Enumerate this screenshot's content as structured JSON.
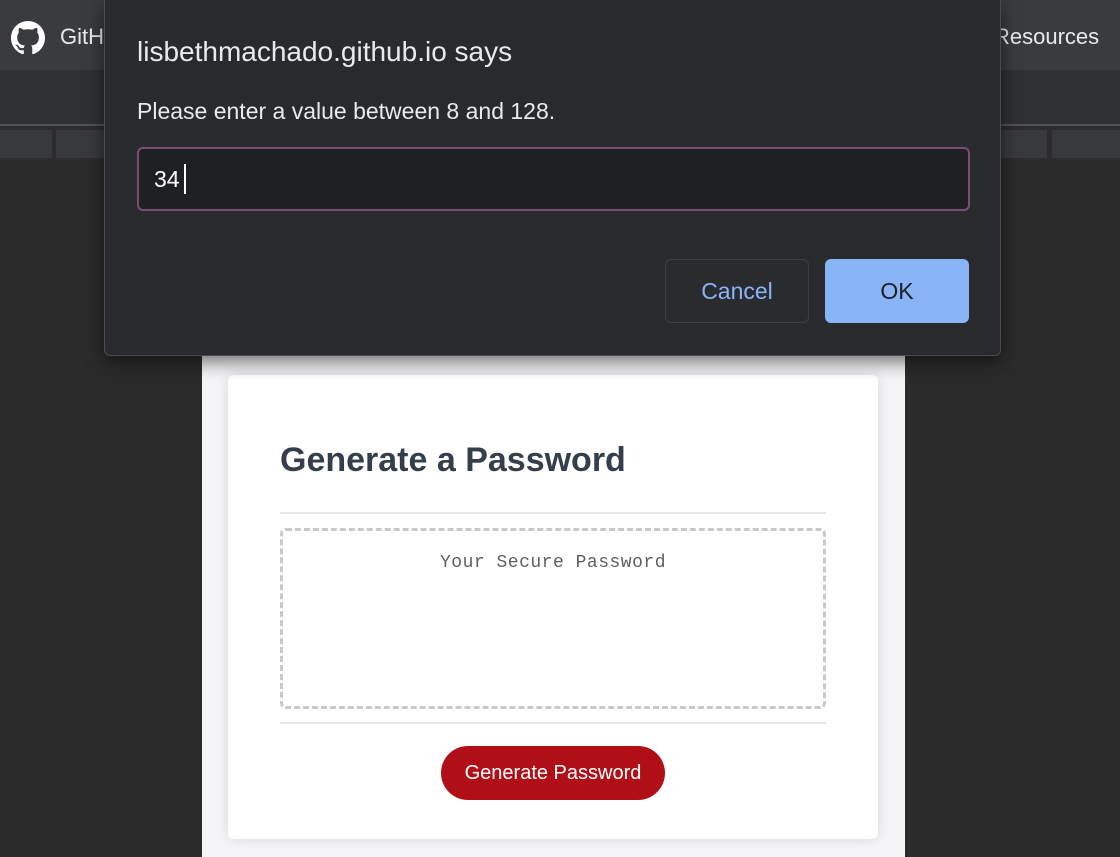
{
  "browser": {
    "bookmarks": {
      "github_label": "GitH",
      "resources_label": "Resources"
    },
    "icons": {
      "github": "github-icon"
    }
  },
  "dialog": {
    "title": "lisbethmachado.github.io says",
    "message": "Please enter a value between 8 and 128.",
    "input_value": "34",
    "cancel_label": "Cancel",
    "ok_label": "OK"
  },
  "card": {
    "title": "Generate a Password",
    "password_placeholder": "Your Secure Password",
    "generate_button_label": "Generate Password"
  },
  "colors": {
    "dialog_bg": "#292a2d",
    "accent_blue": "#8ab4f8",
    "input_focus_border": "#7a4d73",
    "generate_button": "#b10f17",
    "card_title": "#343f4b"
  }
}
